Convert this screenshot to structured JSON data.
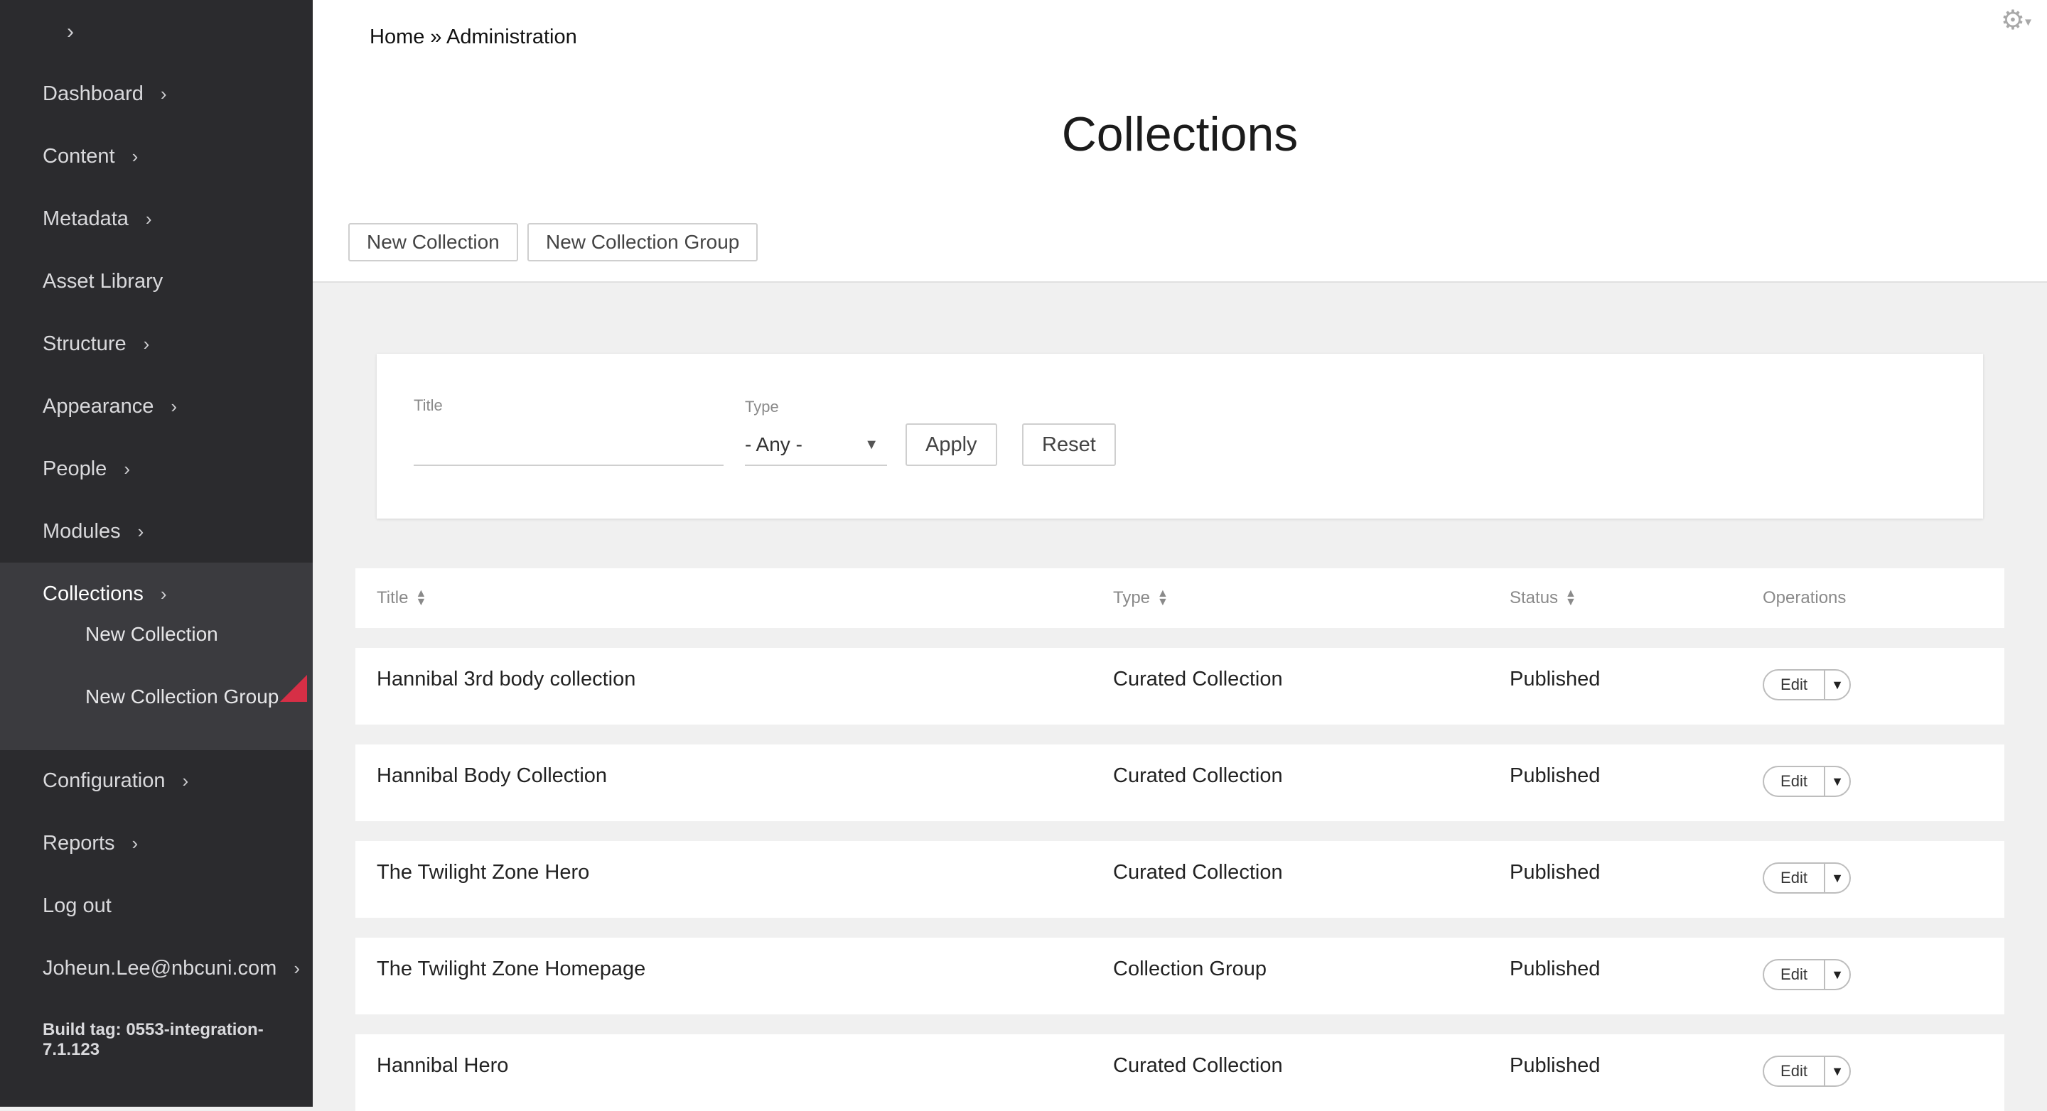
{
  "sidebar": {
    "toggle_icon": "chevron-right-icon",
    "items": [
      {
        "label": "Dashboard"
      },
      {
        "label": "Content"
      },
      {
        "label": "Metadata"
      },
      {
        "label": "Asset Library"
      },
      {
        "label": "Structure"
      },
      {
        "label": "Appearance"
      },
      {
        "label": "People"
      },
      {
        "label": "Modules"
      },
      {
        "label": "Collections"
      },
      {
        "label": "Configuration"
      },
      {
        "label": "Reports"
      },
      {
        "label": "Log out"
      },
      {
        "label": "Joheun.Lee@nbcuni.com"
      }
    ],
    "subitems": [
      {
        "label": "New Collection"
      },
      {
        "label": "New Collection Group"
      }
    ],
    "build_tag": "Build tag: 0553-integration-7.1.123",
    "accent_color": "#d62f46"
  },
  "header": {
    "breadcrumb": "Home » Administration",
    "title": "Collections",
    "buttons": {
      "new_collection": "New Collection",
      "new_collection_group": "New Collection Group"
    }
  },
  "filter": {
    "title_label": "Title",
    "title_value": "",
    "type_label": "Type",
    "type_value": "- Any -",
    "apply": "Apply",
    "reset": "Reset"
  },
  "table": {
    "headers": {
      "title": "Title",
      "type": "Type",
      "status": "Status",
      "operations": "Operations"
    },
    "rows": [
      {
        "title": "Hannibal 3rd body collection",
        "type": "Curated Collection",
        "status": "Published",
        "edit": "Edit"
      },
      {
        "title": "Hannibal Body Collection",
        "type": "Curated Collection",
        "status": "Published",
        "edit": "Edit"
      },
      {
        "title": "The Twilight Zone Hero",
        "type": "Curated Collection",
        "status": "Published",
        "edit": "Edit"
      },
      {
        "title": "The Twilight Zone Homepage",
        "type": "Collection Group",
        "status": "Published",
        "edit": "Edit"
      },
      {
        "title": "Hannibal Hero",
        "type": "Curated Collection",
        "status": "Published",
        "edit": "Edit"
      }
    ]
  }
}
